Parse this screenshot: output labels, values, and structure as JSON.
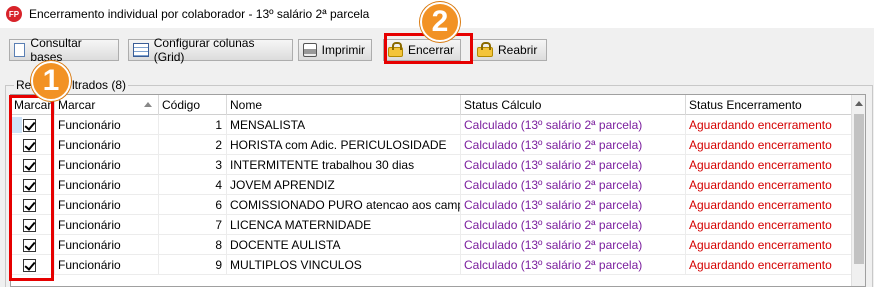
{
  "window": {
    "icon_label": "FP",
    "title": "Encerramento individual por colaborador - 13º salário 2ª parcela"
  },
  "toolbar": {
    "buttons": [
      {
        "label": "Consultar bases",
        "icon": "document-icon"
      },
      {
        "label": "Configurar colunas (Grid)",
        "icon": "grid-icon"
      },
      {
        "label": "Imprimir",
        "icon": "printer-icon"
      },
      {
        "label": "Encerrar",
        "icon": "lock-icon"
      },
      {
        "label": "Reabrir",
        "icon": "lock-icon"
      }
    ]
  },
  "group": {
    "legend_left": "Reg",
    "legend_right": "ltrados (8)"
  },
  "grid": {
    "columns": [
      "Marcar",
      "Marcar",
      "Código",
      "Nome",
      "Status Cálculo",
      "Status Encerramento"
    ],
    "rows": [
      {
        "checked": true,
        "tipo": "Funcionário",
        "codigo": "1",
        "nome": "MENSALISTA",
        "status_calculo": "Calculado (13º salário 2ª parcela)",
        "status_encerramento": "Aguardando encerramento"
      },
      {
        "checked": true,
        "tipo": "Funcionário",
        "codigo": "2",
        "nome": "HORISTA com Adic. PERICULOSIDADE",
        "status_calculo": "Calculado (13º salário 2ª parcela)",
        "status_encerramento": "Aguardando encerramento"
      },
      {
        "checked": true,
        "tipo": "Funcionário",
        "codigo": "3",
        "nome": "INTERMITENTE trabalhou 30 dias",
        "status_calculo": "Calculado (13º salário 2ª parcela)",
        "status_encerramento": "Aguardando encerramento"
      },
      {
        "checked": true,
        "tipo": "Funcionário",
        "codigo": "4",
        "nome": "JOVEM APRENDIZ",
        "status_calculo": "Calculado (13º salário 2ª parcela)",
        "status_encerramento": "Aguardando encerramento"
      },
      {
        "checked": true,
        "tipo": "Funcionário",
        "codigo": "6",
        "nome": "COMISSIONADO PURO   atencao aos campos",
        "status_calculo": "Calculado (13º salário 2ª parcela)",
        "status_encerramento": "Aguardando encerramento"
      },
      {
        "checked": true,
        "tipo": "Funcionário",
        "codigo": "7",
        "nome": "LICENCA MATERNIDADE",
        "status_calculo": "Calculado (13º salário 2ª parcela)",
        "status_encerramento": "Aguardando encerramento"
      },
      {
        "checked": true,
        "tipo": "Funcionário",
        "codigo": "8",
        "nome": "DOCENTE AULISTA",
        "status_calculo": "Calculado (13º salário 2ª parcela)",
        "status_encerramento": "Aguardando encerramento"
      },
      {
        "checked": true,
        "tipo": "Funcionário",
        "codigo": "9",
        "nome": "MULTIPLOS VINCULOS",
        "status_calculo": "Calculado (13º salário 2ª parcela)",
        "status_encerramento": "Aguardando encerramento"
      }
    ]
  },
  "annotations": {
    "badge_1": "1",
    "badge_2": "2",
    "badge_color": "#f29224",
    "highlight_color": "#e60000"
  },
  "colors": {
    "status_calculo": "#7b1f9e",
    "status_encerramento": "#d40000"
  }
}
